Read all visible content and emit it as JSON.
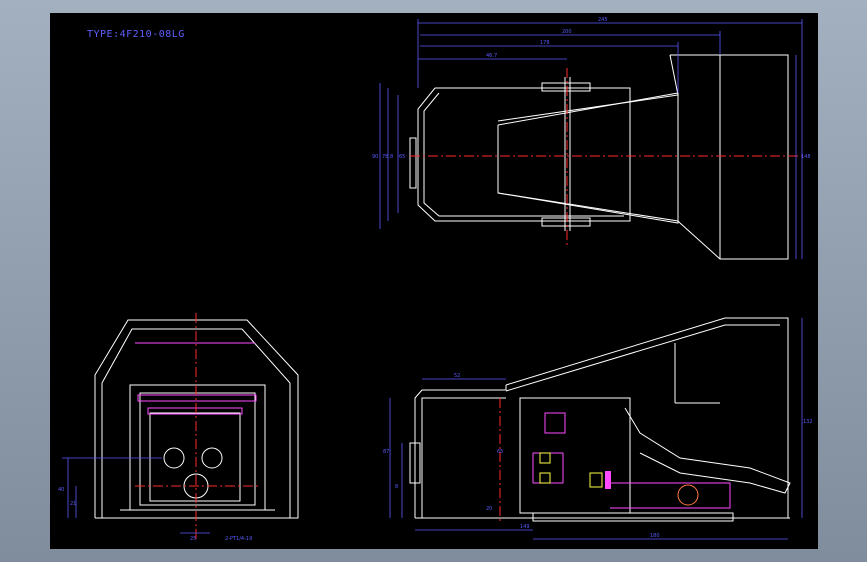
{
  "drawing": {
    "title": "TYPE:4F210-08LG",
    "top_view": {
      "dim_overall": "245",
      "dim_body": "200",
      "dim_pedal": "178",
      "dim_pivot": "46.7",
      "dim_h1": "90",
      "dim_h2": "78.8",
      "dim_h3": "65",
      "dim_right": "148"
    },
    "front_view": {
      "dim_height": "40",
      "dim_h2": "21",
      "dim_bottom": "25",
      "dim_port": "2-PT1/4-19"
    },
    "side_view": {
      "dim_top": "52",
      "dim_h1": "87",
      "dim_h2": "65",
      "dim_h3": "8",
      "dim_base": "20",
      "dim_left": "149",
      "dim_length": "180",
      "dim_right": "132"
    },
    "colors": {
      "outline": "#ffffff",
      "dimension": "#5a5aff",
      "centerline": "#ff2a2a",
      "hatch": "#ff4aff",
      "accent": "#ffff44",
      "hidden": "#ff7a3a"
    }
  }
}
